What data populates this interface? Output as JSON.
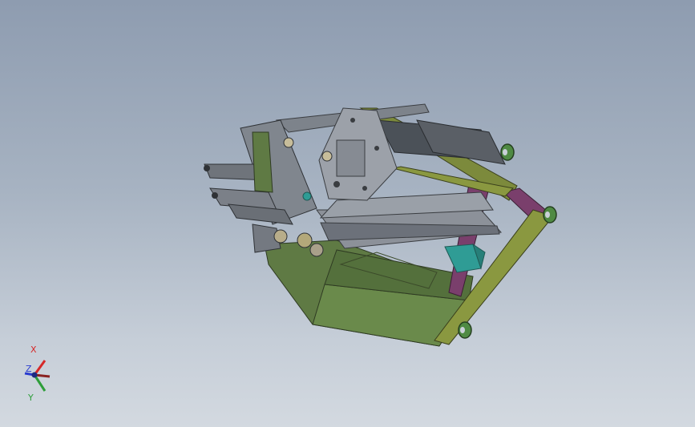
{
  "viewport": {
    "background_top": "#8e9cb0",
    "background_bottom": "#d3d9e0"
  },
  "model": {
    "icon": "machine-assembly-3d-model",
    "colors": {
      "base_box": "#5f7a44",
      "base_box_dark": "#4a6235",
      "frame_profile": "#7c8a3c",
      "frame_accent": "#7a3f6c",
      "plate": "#8f949c",
      "motor": "#2f9c95",
      "wheel": "#4f8a43"
    }
  },
  "triad": {
    "icon": "coordinate-triad-icon",
    "x_label": "X",
    "y_label": "Y",
    "z_label": "Z",
    "x_color": "#d62828",
    "y_color": "#2e9e3a",
    "z_color": "#2a3ccf"
  }
}
